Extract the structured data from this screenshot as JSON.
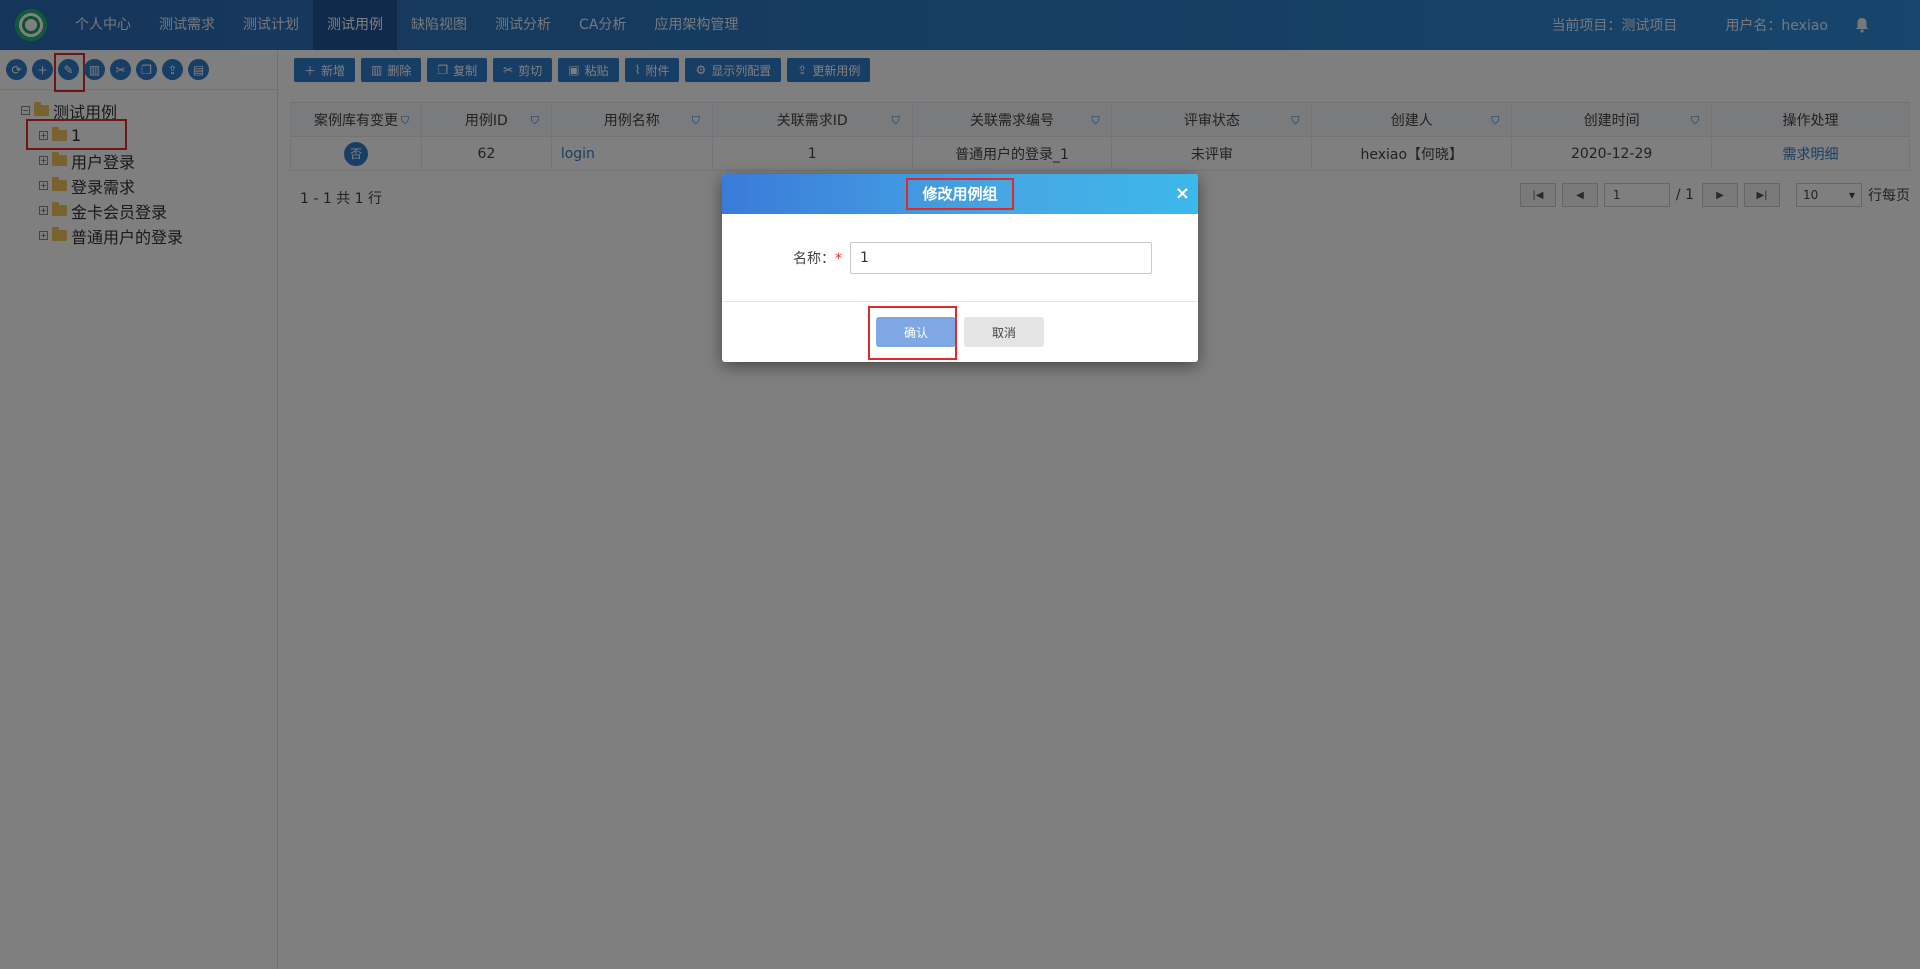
{
  "nav": {
    "items": [
      "个人中心",
      "测试需求",
      "测试计划",
      "测试用例",
      "缺陷视图",
      "测试分析",
      "CA分析",
      "应用架构管理"
    ],
    "active": "测试用例",
    "project": "当前项目：测试项目",
    "user": "用户名：hexiao"
  },
  "left_toolbar": [
    "refresh-icon",
    "add-icon",
    "edit-icon",
    "delete-icon",
    "cut-icon",
    "copy-icon",
    "export-icon",
    "import-icon"
  ],
  "tree": {
    "root": "测试用例",
    "children": [
      "1",
      "用户登录",
      "登录需求",
      "金卡会员登录",
      "普通用户的登录"
    ]
  },
  "toolbar": {
    "add": "新增",
    "delete": "删除",
    "copy": "复制",
    "cut": "剪切",
    "paste": "粘贴",
    "attach": "附件",
    "columns": "显示列配置",
    "update": "更新用例"
  },
  "table": {
    "headers": [
      "案例库有变更",
      "用例ID",
      "用例名称",
      "关联需求ID",
      "关联需求编号",
      "评审状态",
      "创建人",
      "创建时间",
      "操作处理"
    ],
    "rows": [
      {
        "changed": "否",
        "id": "62",
        "name": "login",
        "req_id": "1",
        "req_no": "普通用户的登录_1",
        "review": "未评审",
        "creator": "hexiao【何晓】",
        "created": "2020-12-29",
        "action": "需求明细"
      }
    ]
  },
  "pager": {
    "summary": "1 - 1 共 1 行",
    "page": "1",
    "total": "/ 1",
    "per_page": "10",
    "per_page_label": "行每页"
  },
  "modal": {
    "title": "修改用例组",
    "label": "名称：",
    "required": "*",
    "value": "1",
    "ok": "确认",
    "cancel": "取消"
  },
  "colors": {
    "nav": "#2b6cb4",
    "accent": "#2f7dc8",
    "highlight": "#e02a2a"
  }
}
